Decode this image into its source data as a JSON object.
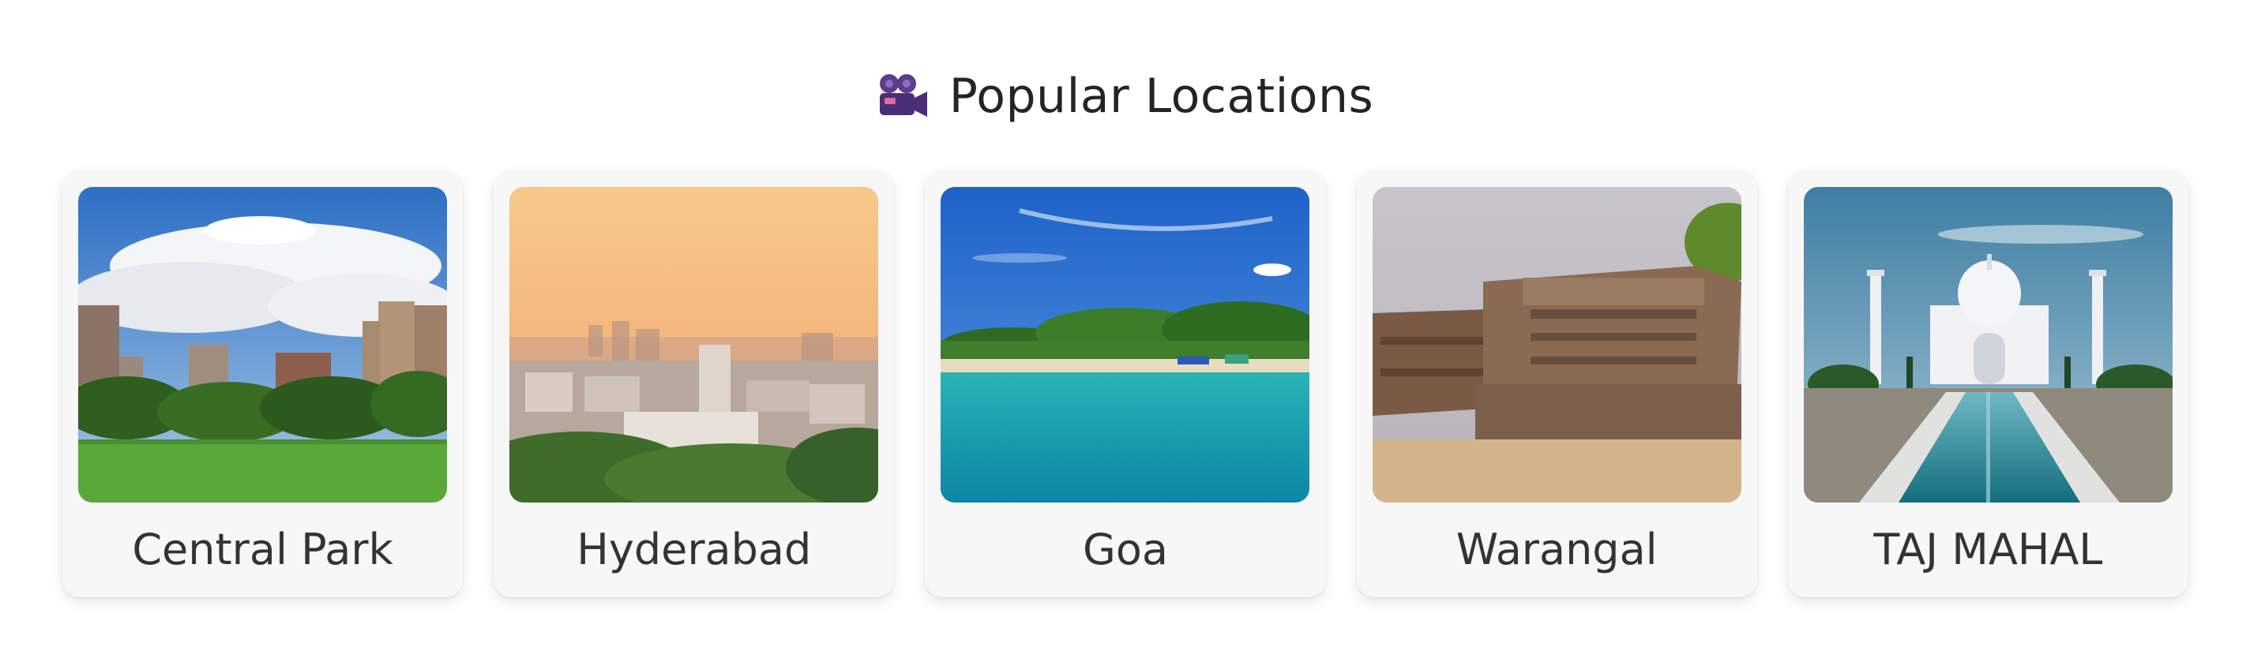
{
  "section": {
    "title": "Popular Locations",
    "icon": "movie-camera-icon"
  },
  "locations": [
    {
      "name": "Central Park",
      "image": "central-park-photo"
    },
    {
      "name": "Hyderabad",
      "image": "hyderabad-skyline-photo"
    },
    {
      "name": "Goa",
      "image": "goa-beach-photo"
    },
    {
      "name": "Warangal",
      "image": "warangal-temple-photo"
    },
    {
      "name": "TAJ MAHAL",
      "image": "taj-mahal-photo"
    }
  ],
  "colors": {
    "card_background": "#f7f7f7",
    "title_text": "#242424",
    "label_text": "#333333",
    "icon_purple": "#5a3e8c"
  }
}
